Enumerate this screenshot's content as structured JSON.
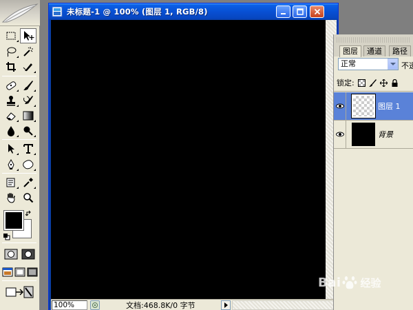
{
  "document": {
    "title": "未标题-1 @ 100% (图层 1, RGB/8)",
    "status_zoom": "100%",
    "status_info": "文档:468.8K/0 字节"
  },
  "layers_panel": {
    "tabs": [
      {
        "label": "图层",
        "active": true
      },
      {
        "label": "通道",
        "active": false
      },
      {
        "label": "路径",
        "active": false
      }
    ],
    "blend_mode": "正常",
    "opacity_label": "不透",
    "lock_label": "锁定:",
    "layers": [
      {
        "name": "图层 1",
        "selected": true,
        "visible": true,
        "thumbnail": "transparent"
      },
      {
        "name": "背景",
        "selected": false,
        "visible": true,
        "thumbnail": "black"
      }
    ]
  },
  "toolbox": {
    "selected_tool": "move-tool",
    "foreground_color": "#000000",
    "background_color": "#ffffff"
  },
  "colors": {
    "titlebar": "#0850d3",
    "selection": "#5a82d8",
    "panel_bg": "#ece9d8",
    "canvas": "#000000"
  },
  "watermark": {
    "text_a": "Bai",
    "text_b": "经验"
  }
}
